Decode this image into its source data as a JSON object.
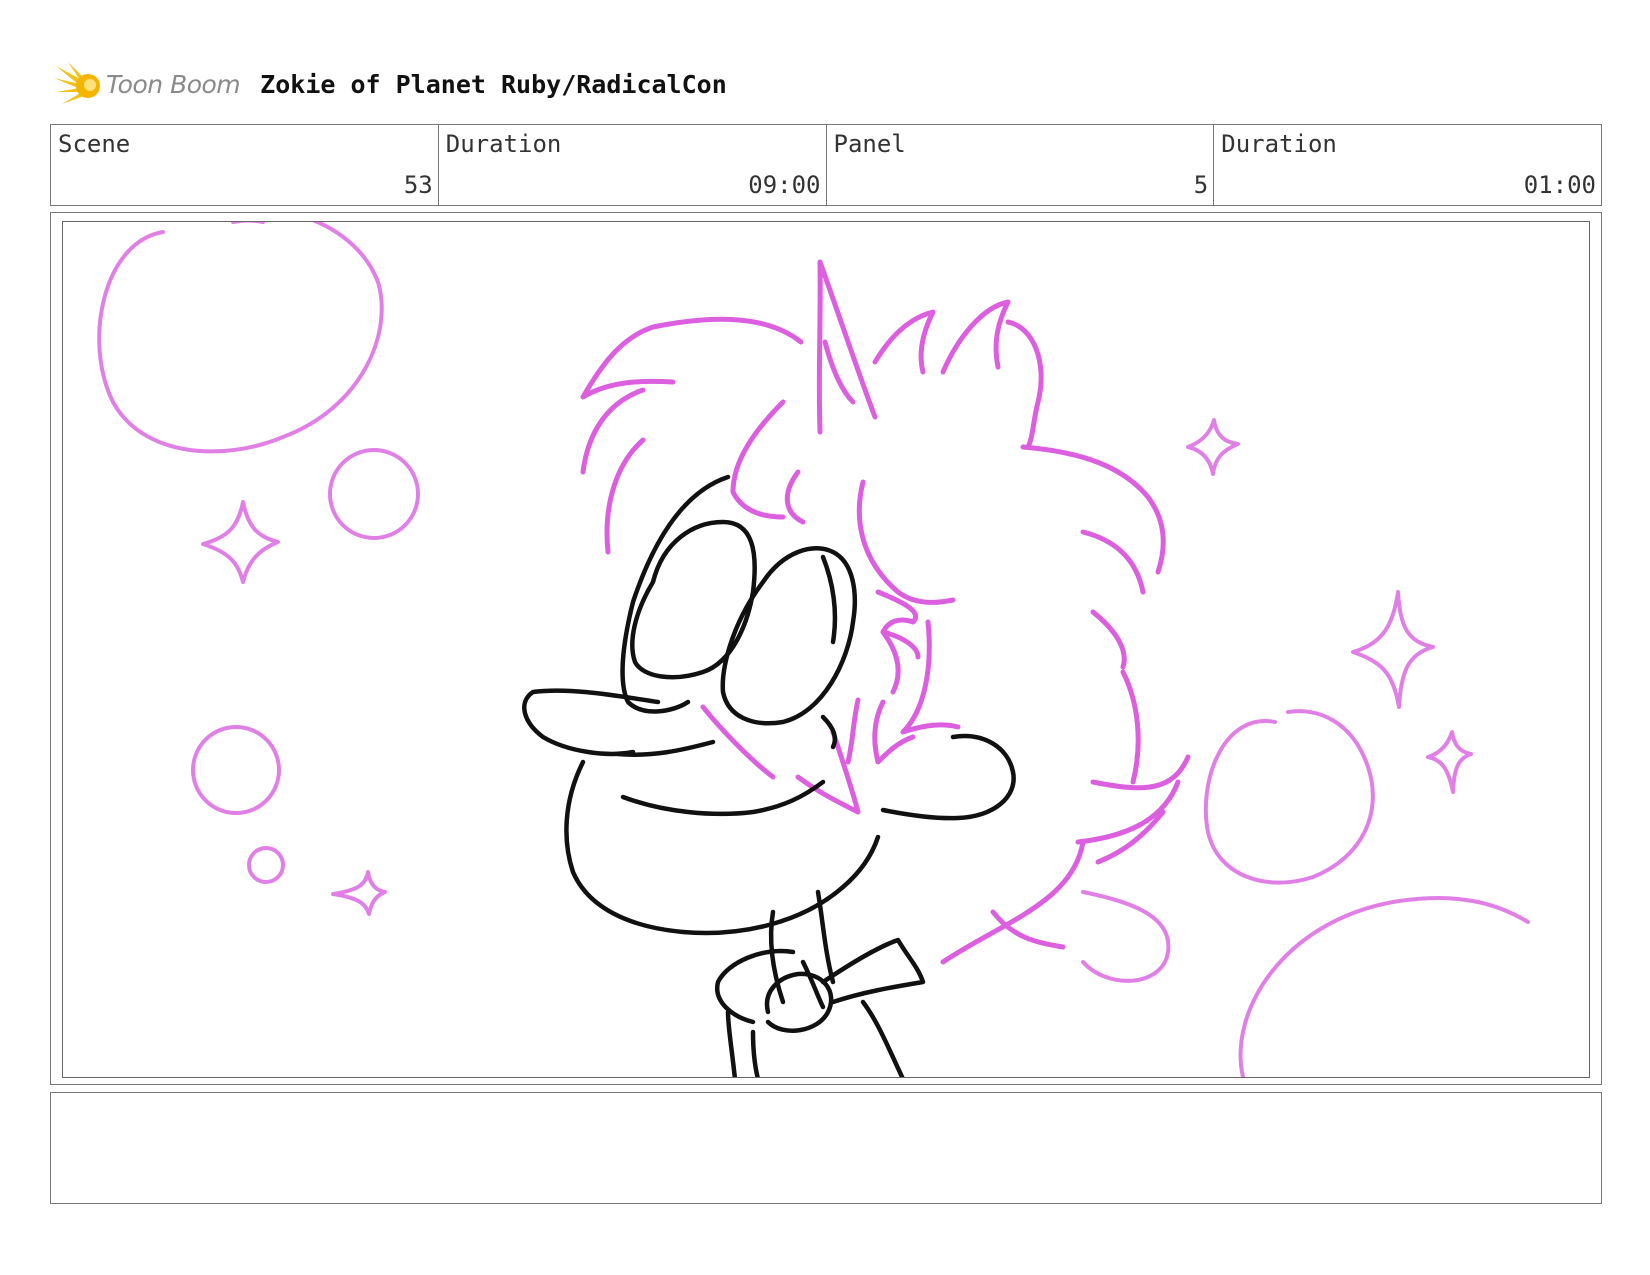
{
  "header": {
    "logo_text": "Toon Boom",
    "project_title": "Zokie of Planet Ruby/RadicalCon"
  },
  "info": [
    {
      "label": "Scene",
      "value": "53"
    },
    {
      "label": "Duration",
      "value": "09:00"
    },
    {
      "label": "Panel",
      "value": "5"
    },
    {
      "label": "Duration",
      "value": "01:00"
    }
  ],
  "panel": {
    "icon": "storyboard-sketch",
    "colors": {
      "sketch_pink": "#dd6ee0",
      "sketch_black": "#111111"
    }
  },
  "notes": {
    "text": ""
  }
}
